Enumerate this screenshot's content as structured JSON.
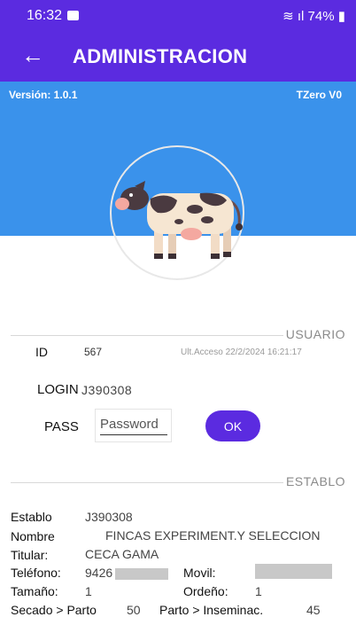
{
  "status_bar": {
    "time": "16:32",
    "battery": "74%"
  },
  "app_bar": {
    "title": "ADMINISTRACION"
  },
  "banner": {
    "version": "Versión: 1.0.1",
    "server": "TZero V0"
  },
  "usuario": {
    "section_label": "USUARIO",
    "id_label": "ID",
    "id_value": "567",
    "last_access_label": "Ult.Acceso",
    "last_access_value": "22/2/2024 16:21:17",
    "login_label": "LOGIN",
    "login_value": "J390308",
    "pass_label": "PASS",
    "pass_placeholder": "Password",
    "ok_label": "OK"
  },
  "establo": {
    "section_label": "ESTABLO",
    "establo_label": "Establo",
    "establo_value": "J390308",
    "nombre_label": "Nombre",
    "nombre_value": "FINCAS EXPERIMENT.Y SELECCION",
    "titular_label": "Titular:",
    "titular_value": "CECA GAMA",
    "telefono_label": "Teléfono:",
    "telefono_value": "9426",
    "movil_label": "Movil:",
    "tamano_label": "Tamaño:",
    "tamano_value": "1",
    "ordeno_label": "Ordeño:",
    "ordeno_value": "1",
    "secado_label": "Secado > Parto",
    "secado_value": "50",
    "parto_label": "Parto > Inseminac.",
    "parto_value": "45"
  },
  "colors": {
    "primary": "#5b2be0",
    "banner": "#3a92eb"
  }
}
